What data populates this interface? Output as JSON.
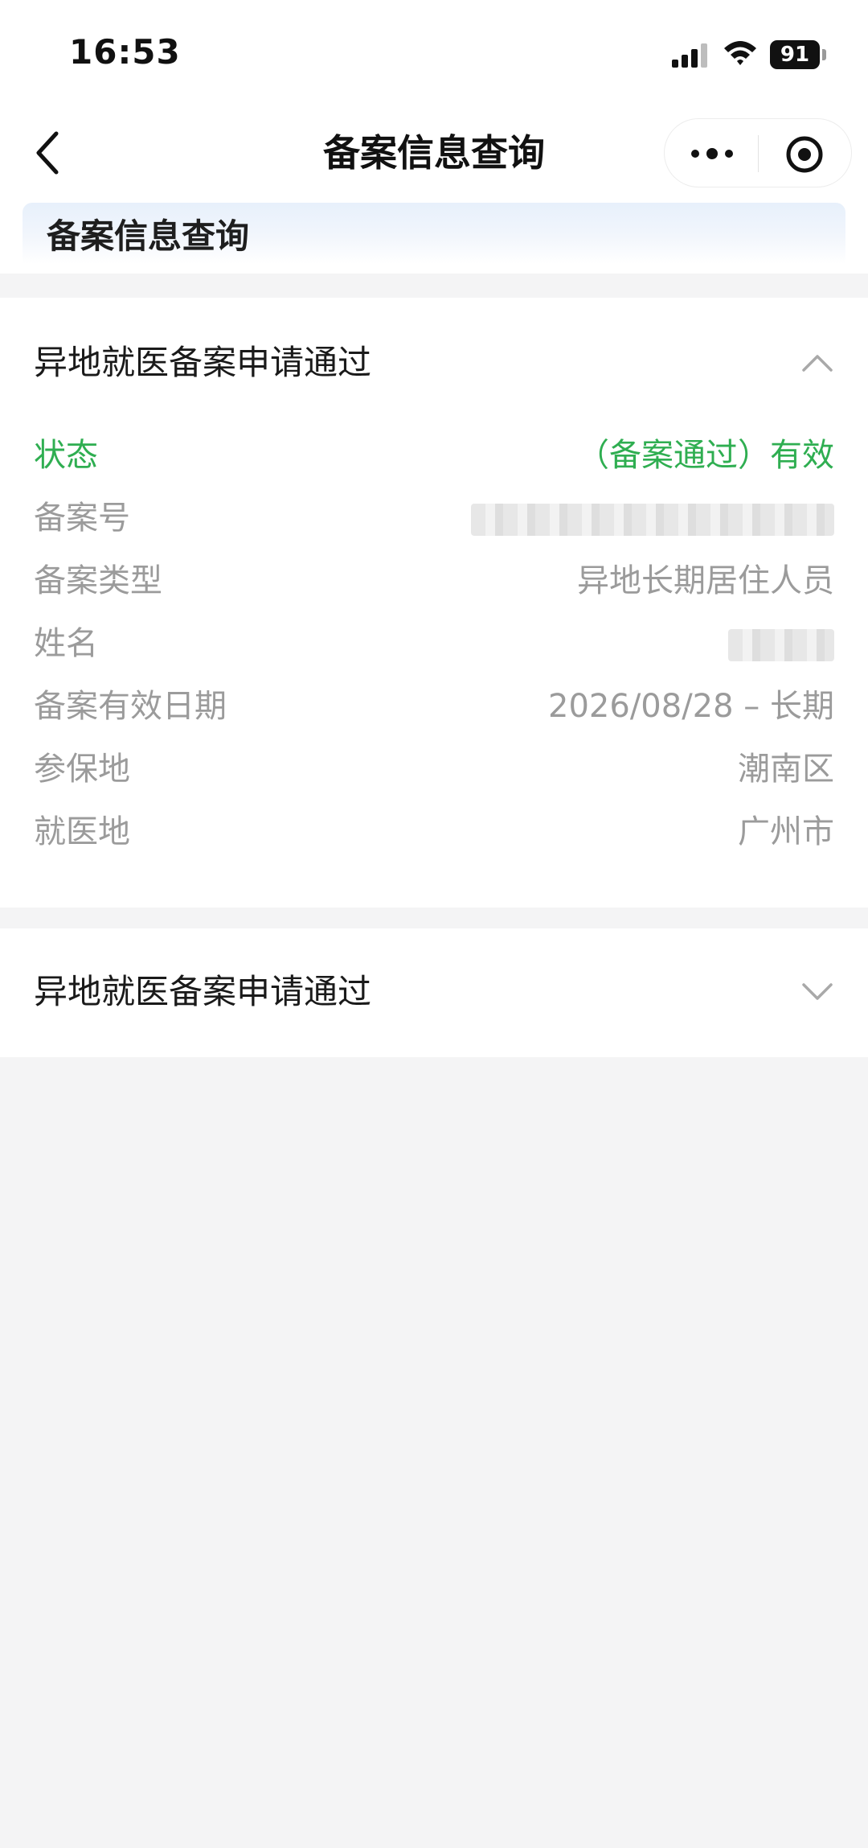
{
  "status_bar": {
    "time": "16:53",
    "battery": "91"
  },
  "nav": {
    "title": "备案信息查询"
  },
  "banner": {
    "title": "备案信息查询"
  },
  "cards": [
    {
      "title": "异地就医备案申请通过",
      "expanded": true,
      "rows": [
        {
          "label": "状态",
          "value": "（备案通过）有效",
          "highlight": true
        },
        {
          "label": "备案号",
          "value": ""
        },
        {
          "label": "备案类型",
          "value": "异地长期居住人员"
        },
        {
          "label": "姓名",
          "value": ""
        },
        {
          "label": "备案有效日期",
          "value": "2026/08/28 – 长期"
        },
        {
          "label": "参保地",
          "value": "潮南区"
        },
        {
          "label": "就医地",
          "value": "广州市"
        }
      ]
    },
    {
      "title": "异地就医备案申请通过",
      "expanded": false
    }
  ],
  "colors": {
    "accent_green": "#2fae51",
    "page_background": "#f4f4f5",
    "muted_text": "#9b9b9b"
  },
  "icons": {
    "back": "chevron-left-icon",
    "more": "more-dots-icon",
    "close": "target-circle-icon",
    "collapse": "chevron-up-icon",
    "expand": "chevron-down-icon"
  }
}
